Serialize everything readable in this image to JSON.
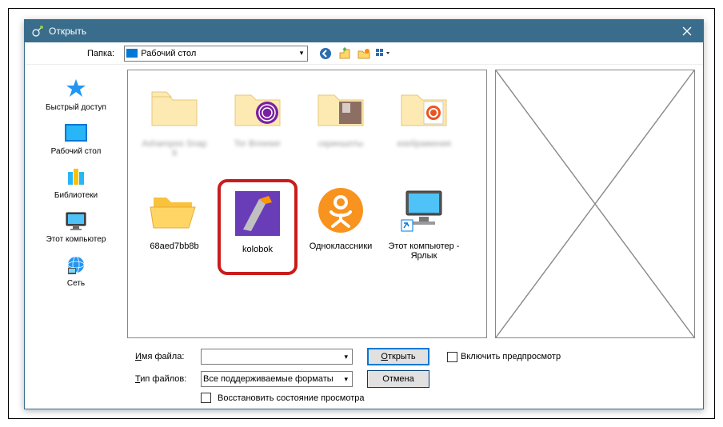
{
  "titlebar": {
    "title": "Открыть"
  },
  "toolbar": {
    "folder_label": "Папка:",
    "current_folder": "Рабочий стол"
  },
  "sidebar": {
    "items": [
      {
        "label": "Быстрый доступ"
      },
      {
        "label": "Рабочий стол"
      },
      {
        "label": "Библиотеки"
      },
      {
        "label": "Этот компьютер"
      },
      {
        "label": "Сеть"
      }
    ]
  },
  "files": {
    "row1": [
      {
        "label": "Ashampoo Snap 9"
      },
      {
        "label": "Tor Browser"
      },
      {
        "label": "скриншоты"
      },
      {
        "label": "изображения"
      }
    ],
    "row2": [
      {
        "label": "68aed7bb8b"
      },
      {
        "label": "kolobok"
      },
      {
        "label": "Одноклассники"
      },
      {
        "label": "Этот компьютер - Ярлык"
      }
    ]
  },
  "bottom": {
    "filename_label": "Имя файла:",
    "filename_value": "",
    "filetype_label": "Тип файлов:",
    "filetype_value": "Все поддерживаемые форматы",
    "open_btn": "Открыть",
    "cancel_btn": "Отмена",
    "restore_checkbox": "Восстановить состояние просмотра",
    "preview_checkbox": "Включить предпросмотр"
  }
}
